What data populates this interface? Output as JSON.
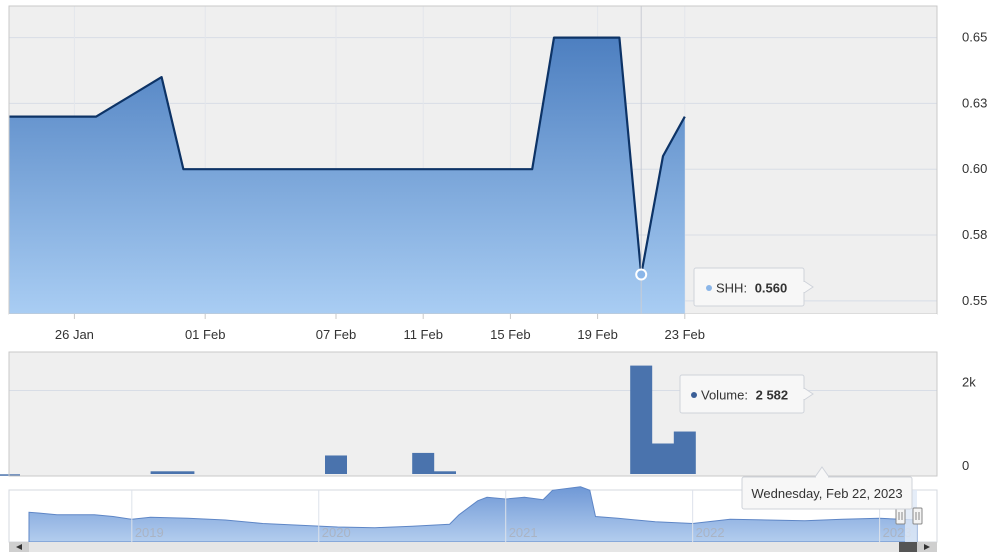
{
  "chart_data": {
    "type": "area",
    "price": {
      "series_name": "SHH",
      "x_ticks": [
        {
          "day": 26,
          "label": "26 Jan"
        },
        {
          "day": 32,
          "label": "01 Feb"
        },
        {
          "day": 38,
          "label": "07 Feb"
        },
        {
          "day": 42,
          "label": "11 Feb"
        },
        {
          "day": 46,
          "label": "15 Feb"
        },
        {
          "day": 50,
          "label": "19 Feb"
        },
        {
          "day": 54,
          "label": "23 Feb"
        }
      ],
      "points": [
        {
          "day": 23,
          "value": 0.62
        },
        {
          "day": 24,
          "value": 0.62
        },
        {
          "day": 25,
          "value": 0.62
        },
        {
          "day": 26,
          "value": 0.62
        },
        {
          "day": 27,
          "value": 0.62
        },
        {
          "day": 30,
          "value": 0.635
        },
        {
          "day": 31,
          "value": 0.6
        },
        {
          "day": 32,
          "value": 0.6
        },
        {
          "day": 33,
          "value": 0.6
        },
        {
          "day": 34,
          "value": 0.6
        },
        {
          "day": 37,
          "value": 0.6
        },
        {
          "day": 38,
          "value": 0.6
        },
        {
          "day": 39,
          "value": 0.6
        },
        {
          "day": 40,
          "value": 0.6
        },
        {
          "day": 41,
          "value": 0.6
        },
        {
          "day": 42,
          "value": 0.6
        },
        {
          "day": 43,
          "value": 0.6
        },
        {
          "day": 44,
          "value": 0.6
        },
        {
          "day": 45,
          "value": 0.6
        },
        {
          "day": 46,
          "value": 0.6
        },
        {
          "day": 47,
          "value": 0.6
        },
        {
          "day": 48,
          "value": 0.65
        },
        {
          "day": 51,
          "value": 0.65
        },
        {
          "day": 52,
          "value": 0.56
        },
        {
          "day": 53,
          "value": 0.605
        },
        {
          "day": 54,
          "value": 0.62
        }
      ],
      "y_ticks": [
        "0.65",
        "0.63",
        "0.60",
        "0.58",
        "0.55"
      ],
      "y_tick_values": [
        0.65,
        0.625,
        0.6,
        0.575,
        0.55
      ],
      "ylim": [
        0.545,
        0.662
      ]
    },
    "volume": {
      "series_name": "Volume",
      "bars": [
        {
          "day": 23,
          "value": 40
        },
        {
          "day": 30,
          "value": 110
        },
        {
          "day": 31,
          "value": 110
        },
        {
          "day": 38,
          "value": 480
        },
        {
          "day": 42,
          "value": 540
        },
        {
          "day": 43,
          "value": 110
        },
        {
          "day": 52,
          "value": 2582
        },
        {
          "day": 53,
          "value": 760
        },
        {
          "day": 54,
          "value": 1040
        }
      ],
      "y_ticks": [
        "2k",
        "0"
      ],
      "y_tick_values": [
        2000,
        0
      ],
      "ylim": [
        0,
        2900
      ]
    },
    "navigator": {
      "labels": [
        "2019",
        "2020",
        "2021",
        "2022",
        "2023"
      ],
      "label_years": [
        2019,
        2020,
        2021,
        2022,
        2023
      ],
      "range": [
        2018.45,
        2023.2
      ],
      "profile": [
        [
          2018.45,
          0.62
        ],
        [
          2018.5,
          0.6
        ],
        [
          2018.6,
          0.55
        ],
        [
          2018.8,
          0.55
        ],
        [
          2018.9,
          0.5
        ],
        [
          2019.0,
          0.42
        ],
        [
          2019.1,
          0.48
        ],
        [
          2019.3,
          0.45
        ],
        [
          2019.5,
          0.4
        ],
        [
          2019.7,
          0.3
        ],
        [
          2019.9,
          0.25
        ],
        [
          2020.1,
          0.2
        ],
        [
          2020.3,
          0.18
        ],
        [
          2020.5,
          0.22
        ],
        [
          2020.7,
          0.28
        ],
        [
          2020.75,
          0.55
        ],
        [
          2020.85,
          0.95
        ],
        [
          2020.9,
          1.05
        ],
        [
          2021.0,
          1.0
        ],
        [
          2021.1,
          1.05
        ],
        [
          2021.2,
          0.98
        ],
        [
          2021.25,
          1.25
        ],
        [
          2021.4,
          1.35
        ],
        [
          2021.45,
          1.25
        ],
        [
          2021.48,
          0.5
        ],
        [
          2021.6,
          0.45
        ],
        [
          2021.8,
          0.35
        ],
        [
          2022.0,
          0.3
        ],
        [
          2022.2,
          0.42
        ],
        [
          2022.4,
          0.4
        ],
        [
          2022.6,
          0.38
        ],
        [
          2022.8,
          0.42
        ],
        [
          2023.0,
          0.45
        ],
        [
          2023.2,
          0.4
        ]
      ]
    },
    "tooltip_price": {
      "label": "SHH:",
      "value": "0.560"
    },
    "tooltip_volume": {
      "label": "Volume:",
      "value": "2 582"
    },
    "crosshair_date": "Wednesday, Feb 22, 2023",
    "crosshair_day": 52,
    "colors": {
      "line": "#0d3366",
      "fill_top": "#4d7fc0",
      "fill_bottom": "#a9cdf3",
      "bar": "#4a73ad",
      "plot_bg": "#efefef",
      "grid": "#d8dde6",
      "navigator_fill": "#7fa6de"
    }
  }
}
